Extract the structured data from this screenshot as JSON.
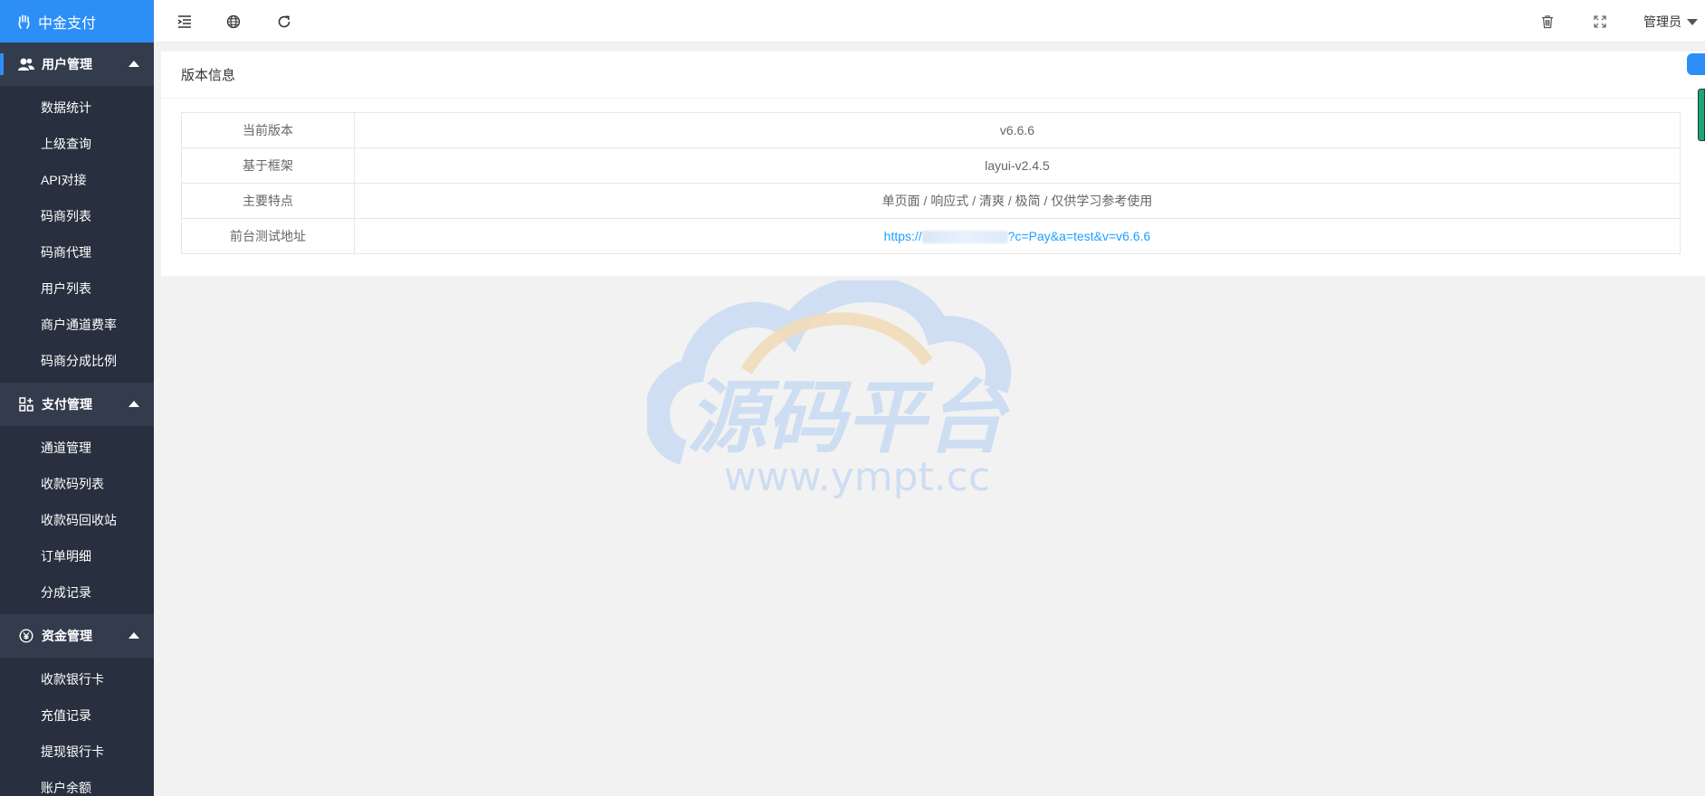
{
  "app": {
    "title": "中金支付"
  },
  "sidebar": {
    "groups": [
      {
        "label": "用户管理",
        "icon": "users-icon",
        "items": [
          "数据统计",
          "上级查询",
          "API对接",
          "码商列表",
          "码商代理",
          "用户列表",
          "商户通道费率",
          "码商分成比例"
        ]
      },
      {
        "label": "支付管理",
        "icon": "grid-plus-icon",
        "items": [
          "通道管理",
          "收款码列表",
          "收款码回收站",
          "订单明细",
          "分成记录"
        ]
      },
      {
        "label": "资金管理",
        "icon": "yen-circle-icon",
        "items": [
          "收款银行卡",
          "充值记录",
          "提现银行卡",
          "账户余额"
        ]
      }
    ]
  },
  "header": {
    "admin_label": "管理员",
    "icons": [
      "menu-collapse-icon",
      "globe-icon",
      "refresh-icon",
      "trash-icon",
      "fullscreen-icon"
    ]
  },
  "card": {
    "title": "版本信息",
    "rows": [
      {
        "label": "当前版本",
        "value": "v6.6.6"
      },
      {
        "label": "基于框架",
        "value": "layui-v2.4.5"
      },
      {
        "label": "主要特点",
        "value": "单页面 / 响应式 / 清爽 / 极简 / 仅供学习参考使用"
      },
      {
        "label": "前台测试地址",
        "value_prefix": "https://",
        "value_suffix": "?c=Pay&a=test&v=v6.6.6"
      }
    ]
  },
  "watermark": {
    "title": "源码平台",
    "url": "www.ympt.cc"
  }
}
